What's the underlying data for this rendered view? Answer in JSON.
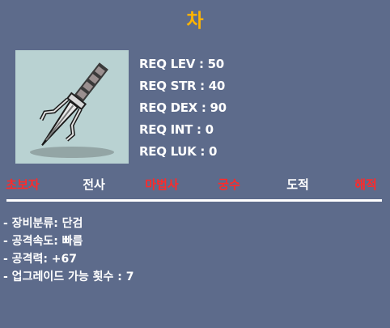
{
  "item": {
    "name": "차",
    "icon": "trident-dagger-icon"
  },
  "requirements": [
    "REQ LEV : 50",
    "REQ STR : 40",
    "REQ DEX : 90",
    "REQ INT : 0",
    "REQ LUK : 0"
  ],
  "jobs": [
    {
      "label": "초보자",
      "color": "#ff2a2a"
    },
    {
      "label": "전사",
      "color": "#ffffff"
    },
    {
      "label": "마법사",
      "color": "#ff2a2a"
    },
    {
      "label": "궁수",
      "color": "#ff2a2a"
    },
    {
      "label": "도적",
      "color": "#ffffff"
    },
    {
      "label": "해적",
      "color": "#ff2a2a"
    }
  ],
  "details": [
    "- 장비분류: 단검",
    "- 공격속도: 빠름",
    "- 공격력: +67",
    "- 업그레이드 가능 횟수 : 7"
  ],
  "colors": {
    "background": "#5d6b8b",
    "title": "#ffb400",
    "icon_bg": "#b9d2d2"
  }
}
